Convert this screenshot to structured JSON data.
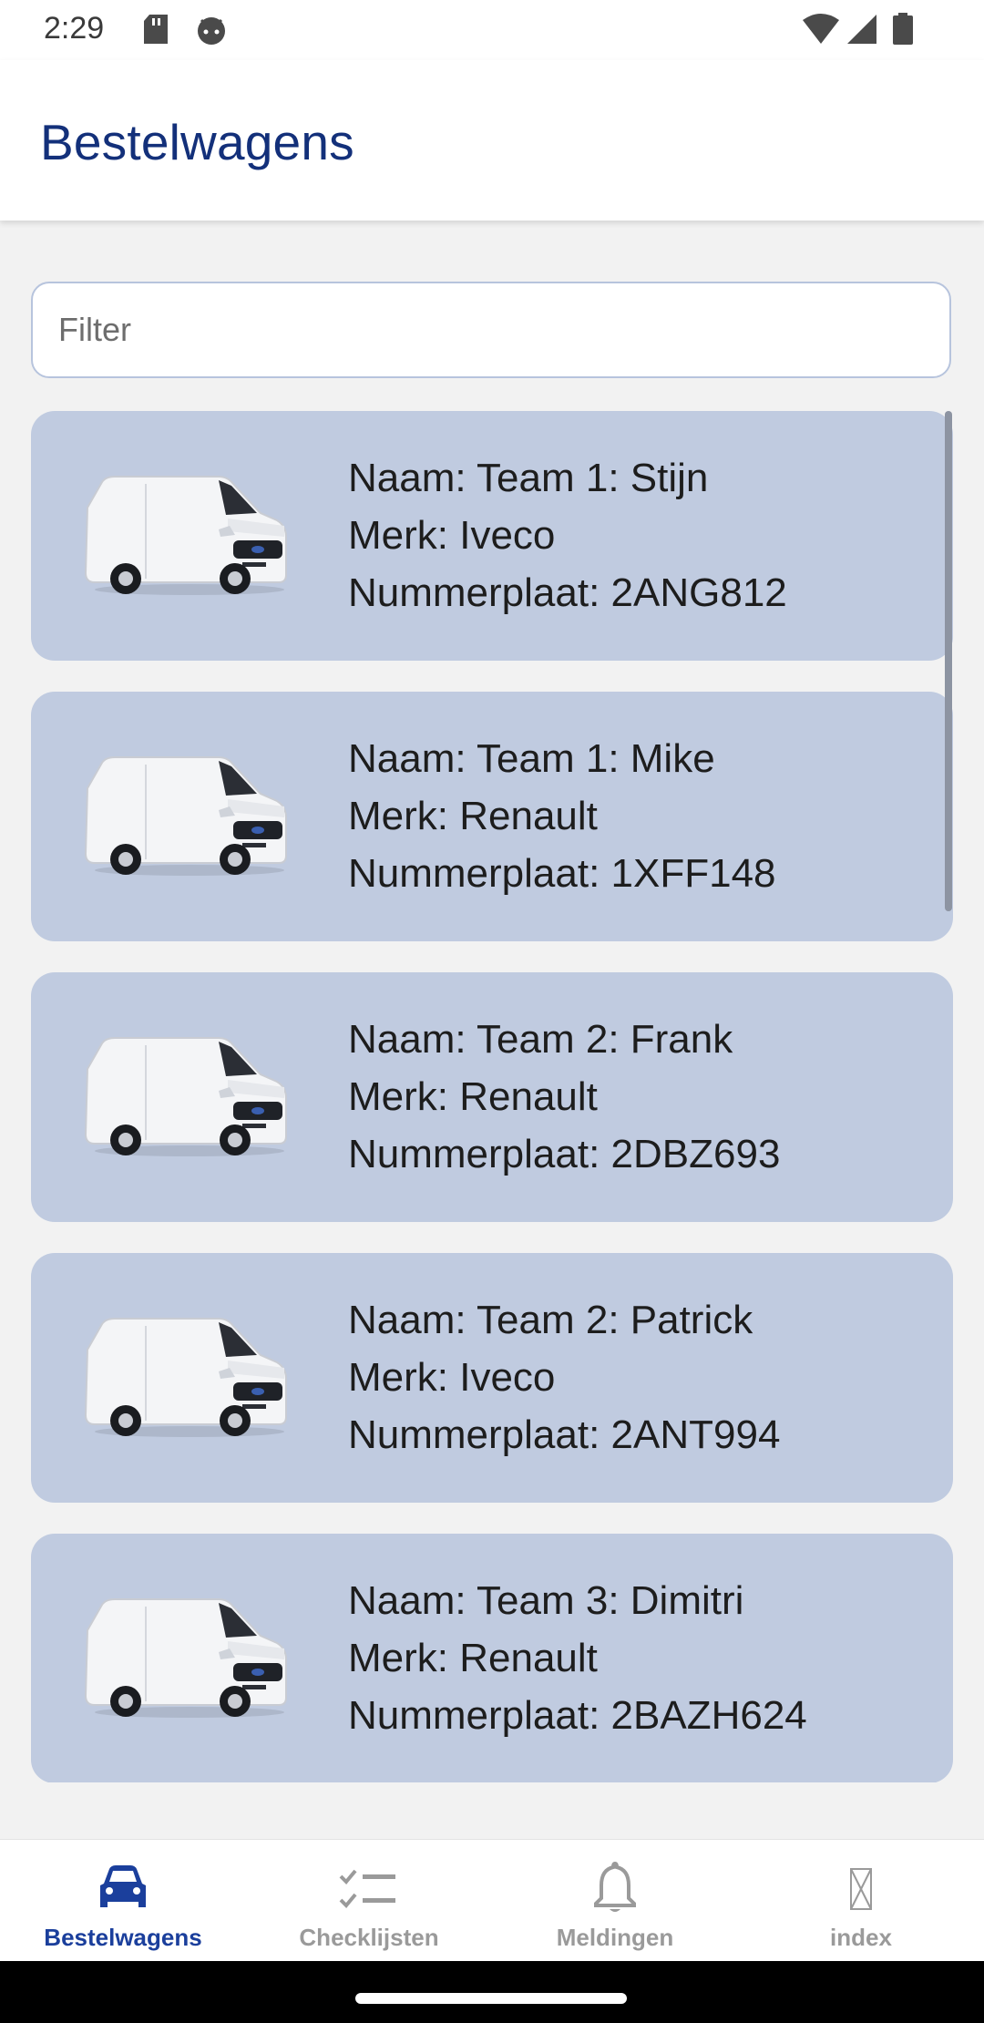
{
  "status_bar": {
    "time": "2:29",
    "left_icons": [
      "sd-card-icon",
      "android-face-icon"
    ],
    "right_icons": [
      "wifi-icon",
      "signal-icon",
      "battery-icon"
    ]
  },
  "header": {
    "title": "Bestelwagens"
  },
  "filter": {
    "placeholder": "Filter",
    "value": ""
  },
  "vans": [
    {
      "name": "Naam: Team 1: Stijn",
      "brand": "Merk: Iveco",
      "plate": "Nummerplaat: 2ANG812"
    },
    {
      "name": "Naam: Team 1: Mike",
      "brand": "Merk: Renault",
      "plate": "Nummerplaat: 1XFF148"
    },
    {
      "name": "Naam: Team 2: Frank",
      "brand": "Merk: Renault",
      "plate": "Nummerplaat: 2DBZ693"
    },
    {
      "name": "Naam: Team 2: Patrick",
      "brand": "Merk: Iveco",
      "plate": "Nummerplaat: 2ANT994"
    },
    {
      "name": "Naam: Team 3: Dimitri",
      "brand": "Merk: Renault",
      "plate": "Nummerplaat: 2BAZH624"
    }
  ],
  "bottom_nav": [
    {
      "label": "Bestelwagens",
      "icon": "car-icon",
      "active": true
    },
    {
      "label": "Checklijsten",
      "icon": "checklist-icon",
      "active": false
    },
    {
      "label": "Meldingen",
      "icon": "bell-icon",
      "active": false
    },
    {
      "label": "index",
      "icon": "missing-glyph-icon",
      "active": false
    }
  ],
  "colors": {
    "primary": "#1b3f9c",
    "title": "#13307a",
    "card_background": "#c0cbe0",
    "inactive_nav": "#9a9a9a"
  }
}
